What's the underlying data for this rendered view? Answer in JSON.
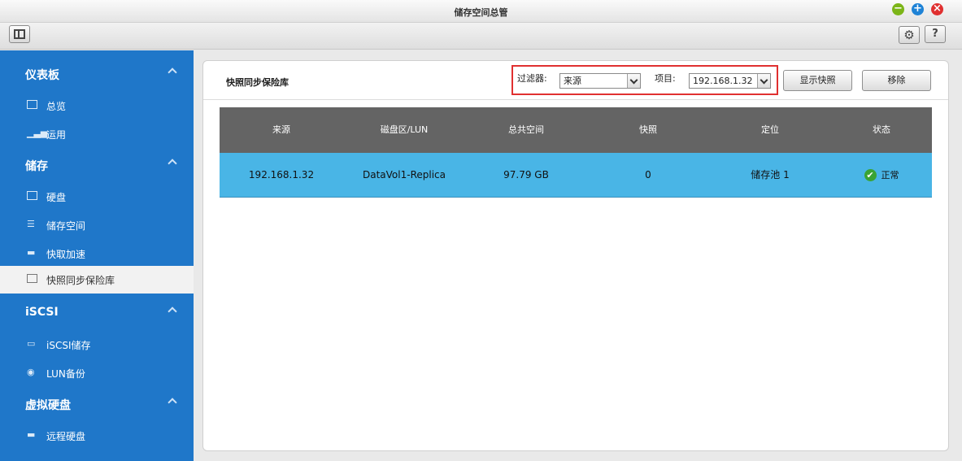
{
  "window": {
    "title": "储存空间总管"
  },
  "icons": {
    "panel": "sidebar-toggle-icon",
    "gear": "gear-icon",
    "help": "help-icon"
  },
  "toolbar": {
    "help_label": "?"
  },
  "sidebar": {
    "sections": [
      {
        "label": "仪表板",
        "items": [
          {
            "label": "总览"
          },
          {
            "label": "运用"
          }
        ]
      },
      {
        "label": "储存",
        "items": [
          {
            "label": "硬盘"
          },
          {
            "label": "储存空间"
          },
          {
            "label": "快取加速"
          },
          {
            "label": "快照同步保险库"
          }
        ]
      },
      {
        "label": "iSCSI",
        "items": [
          {
            "label": "iSCSI储存"
          },
          {
            "label": "LUN备份"
          }
        ]
      },
      {
        "label": "虚拟硬盘",
        "items": [
          {
            "label": "远程硬盘"
          }
        ]
      }
    ],
    "active_item": "快照同步保险库"
  },
  "main": {
    "title": "快照同步保险库",
    "filter": {
      "label": "过滤器:",
      "value": "来源"
    },
    "item": {
      "label": "项目:",
      "value": "192.168.1.32"
    },
    "buttons": {
      "show_snapshot": "显示快照",
      "remove": "移除"
    },
    "table": {
      "columns": [
        "来源",
        "磁盘区/LUN",
        "总共空间",
        "快照",
        "定位",
        "状态"
      ],
      "rows": [
        {
          "source": "192.168.1.32",
          "volume": "DataVol1-Replica",
          "total": "97.79 GB",
          "snapshots": "0",
          "location": "储存池 1",
          "status": "正常"
        }
      ]
    }
  },
  "colors": {
    "sidebar": "#1f77c9",
    "row_selected": "#49b5e6",
    "header": "#646464",
    "highlight_border": "#e03030"
  }
}
